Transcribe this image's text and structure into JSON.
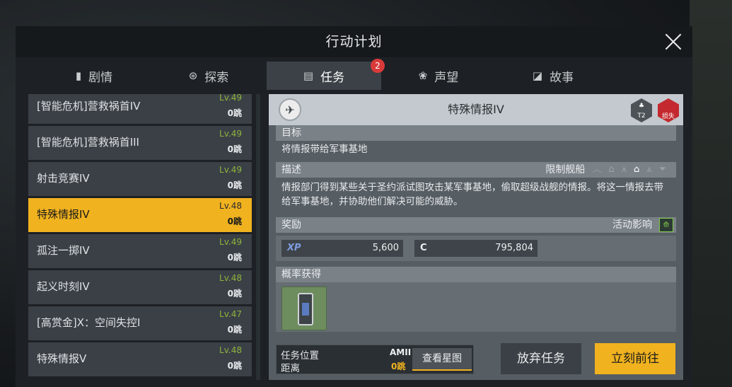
{
  "window": {
    "title": "行动计划"
  },
  "tabs": [
    {
      "label": "剧情",
      "icon": "book-icon"
    },
    {
      "label": "探索",
      "icon": "explore-icon"
    },
    {
      "label": "任务",
      "icon": "task-list-icon",
      "badge": "2"
    },
    {
      "label": "声望",
      "icon": "reputation-icon"
    },
    {
      "label": "故事",
      "icon": "story-icon"
    }
  ],
  "missions": [
    {
      "name": "[智能危机]营救祸首IV",
      "level": "Lv.49",
      "distance": "0跳"
    },
    {
      "name": "[智能危机]营救祸首III",
      "level": "Lv.49",
      "distance": "0跳"
    },
    {
      "name": "射击竞赛IV",
      "level": "Lv.49",
      "distance": "0跳"
    },
    {
      "name": "特殊情报IV",
      "level": "Lv.48",
      "distance": "0跳"
    },
    {
      "name": "孤注一掷IV",
      "level": "Lv.49",
      "distance": "0跳"
    },
    {
      "name": "起义时刻IV",
      "level": "Lv.48",
      "distance": "0跳"
    },
    {
      "name": "[高赏金]X：空间失控I",
      "level": "Lv.47",
      "distance": "0跳"
    },
    {
      "name": "特殊情报V",
      "level": "Lv.48",
      "distance": "0跳"
    }
  ],
  "detail": {
    "title": "特殊情报IV",
    "tier_badge": "T2",
    "risk_badge": "损失",
    "objective_label": "目标",
    "objective": "将情报带给军事基地",
    "description_label": "描述",
    "restrict_label": "限制舰船",
    "description": "情报部门得到某些关于圣约派试图攻击某军事基地，偷取超级战舰的情报。将这一情报去带给军事基地，并协助他们解决可能的威胁。",
    "reward_label": "奖励",
    "activity_label": "活动影响",
    "xp_tag": "XP",
    "xp_value": "5,600",
    "credit_tag": "C",
    "credit_value": "795,804",
    "loot_label": "概率获得"
  },
  "footer": {
    "location_label": "任务位置",
    "distance_label": "距离",
    "location_value": "AMII",
    "distance_value": "0跳",
    "starmap_button": "查看星图",
    "abandon_button": "放弃任务",
    "go_button": "立刻前往"
  },
  "colors": {
    "accent": "#f0b21f",
    "level_green": "#8db43c",
    "badge_red": "#d93a3a"
  }
}
